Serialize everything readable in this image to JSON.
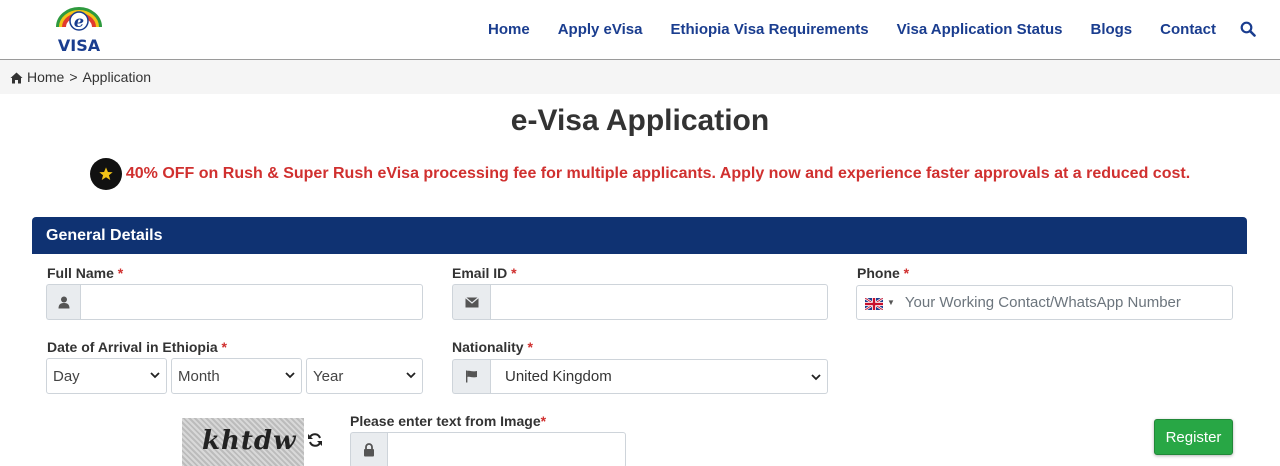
{
  "logo": {
    "top_letter": "e",
    "text": "VISA"
  },
  "nav": {
    "items": [
      {
        "label": "Home"
      },
      {
        "label": "Apply eVisa"
      },
      {
        "label": "Ethiopia Visa Requirements"
      },
      {
        "label": "Visa Application Status"
      },
      {
        "label": "Blogs"
      },
      {
        "label": "Contact"
      }
    ],
    "search_icon": "search-icon"
  },
  "breadcrumb": {
    "home": "Home",
    "separator": ">",
    "current": "Application"
  },
  "page": {
    "title": "e-Visa Application",
    "promo": "40% OFF on Rush & Super Rush eVisa processing fee for multiple applicants. Apply now and experience faster approvals at a reduced cost."
  },
  "general_details": {
    "heading": "General Details",
    "full_name": {
      "label": "Full Name",
      "required": "*",
      "value": ""
    },
    "email": {
      "label": "Email ID",
      "required": "*",
      "value": ""
    },
    "phone": {
      "label": "Phone",
      "required": "*",
      "placeholder": "Your Working Contact/WhatsApp Number"
    },
    "arrival": {
      "label": "Date of Arrival in Ethiopia",
      "required": "*",
      "day": "Day",
      "month": "Month",
      "year": "Year"
    },
    "nationality": {
      "label": "Nationality",
      "required": "*",
      "value": "United Kingdom"
    },
    "captcha": {
      "label": "Please enter text from Image",
      "required": "*",
      "image_text": "khtdw"
    },
    "register": "Register"
  },
  "colors": {
    "nav_link": "#1a3d8f",
    "panel_head": "#0f3272",
    "promo": "#d0302f",
    "register": "#28a745"
  }
}
